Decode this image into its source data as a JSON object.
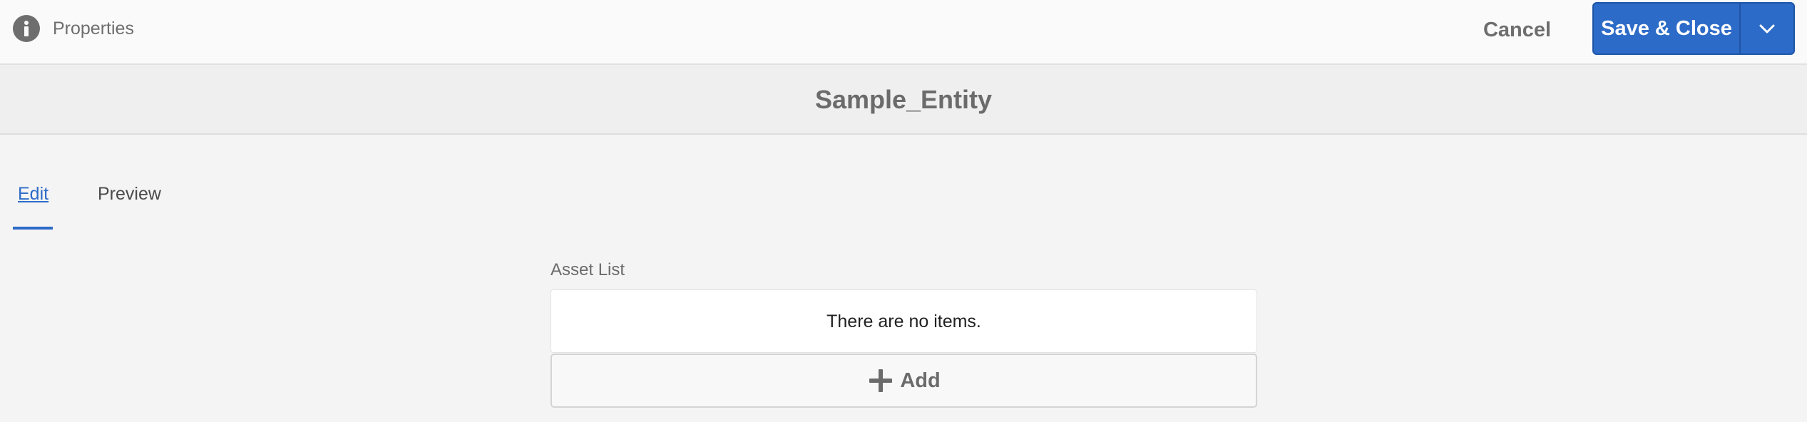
{
  "header": {
    "properties_label": "Properties",
    "cancel_label": "Cancel",
    "save_label": "Save & Close"
  },
  "title": "Sample_Entity",
  "tabs": [
    {
      "label": "Edit",
      "active": true
    },
    {
      "label": "Preview",
      "active": false
    }
  ],
  "asset_list": {
    "label": "Asset List",
    "empty_text": "There are no items.",
    "add_label": "Add"
  },
  "colors": {
    "accent": "#2d6bc8",
    "background": "#f4f4f4",
    "header_background": "#fafafa"
  },
  "icons": {
    "info": "info-icon",
    "dropdown": "chevron-down-icon",
    "add": "plus-icon"
  }
}
